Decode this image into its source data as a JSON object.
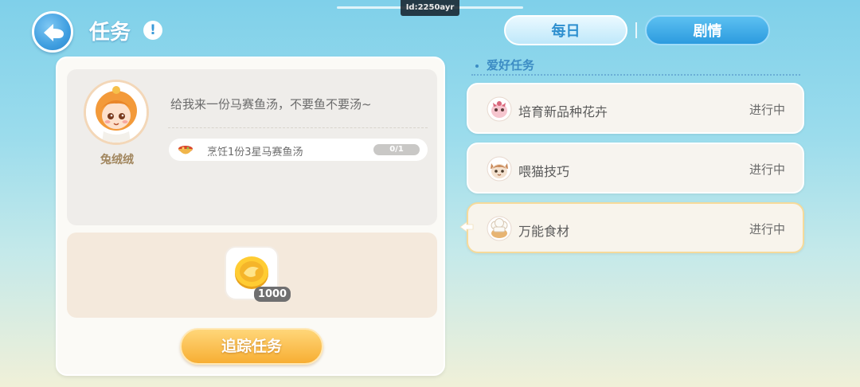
{
  "debug_id": "Id:2250ayr",
  "header": {
    "title": "任务",
    "info_icon": "!"
  },
  "tabs": [
    {
      "label": "每日",
      "active": false
    },
    {
      "label": "剧情",
      "active": true
    }
  ],
  "quest_detail": {
    "npc_name": "兔绒绒",
    "dialogue": "给我来一份马赛鱼汤，不要鱼不要汤~",
    "task": {
      "text": "烹饪1份3星马赛鱼汤",
      "progress": "0/1"
    },
    "reward": {
      "item": "gold-coin",
      "count": "1000"
    },
    "track_button": "追踪任务"
  },
  "quest_list": {
    "section_title": "爱好任务",
    "items": [
      {
        "name": "培育新品种花卉",
        "status": "进行中",
        "icon": "flower-pet-icon",
        "selected": false
      },
      {
        "name": "喂猫技巧",
        "status": "进行中",
        "icon": "cat-face-icon",
        "selected": false
      },
      {
        "name": "万能食材",
        "status": "进行中",
        "icon": "chef-hat-icon",
        "selected": true
      }
    ]
  },
  "colors": {
    "accent_blue": "#2c9bdf",
    "button_orange": "#f7ae33",
    "heading_blue": "#3c8cc4",
    "selected_border": "#f6da9a"
  }
}
